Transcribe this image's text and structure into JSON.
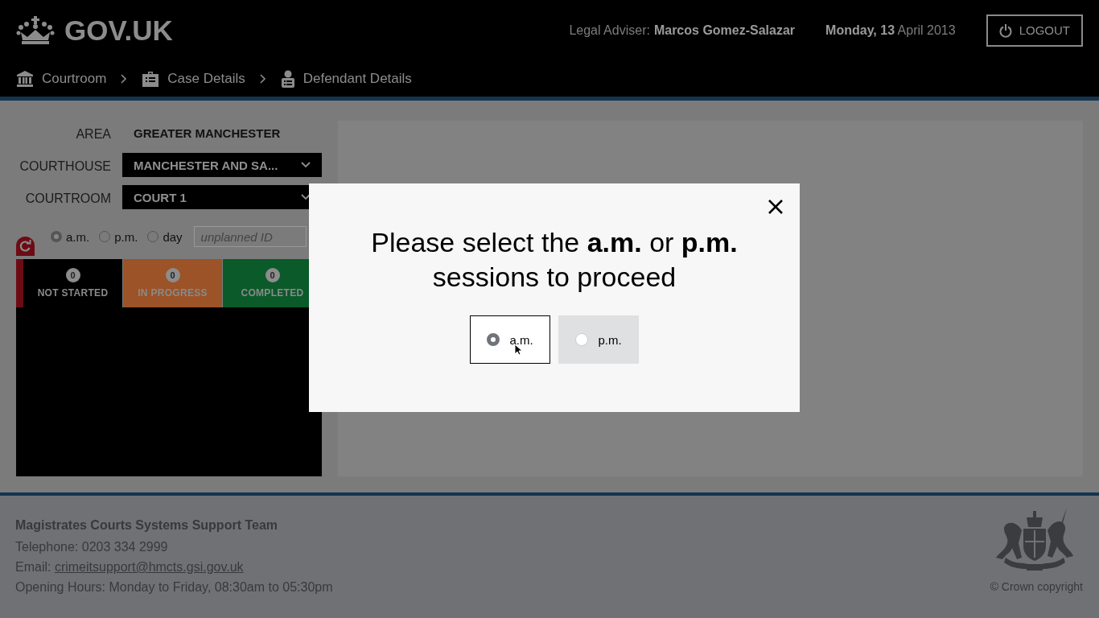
{
  "header": {
    "logo_text": "GOV.UK",
    "adviser_label": "Legal Adviser:",
    "adviser_name": "Marcos Gomez-Salazar",
    "date": "**Monday, 13** April 2013",
    "logout": "LOGOUT"
  },
  "breadcrumbs": [
    {
      "label": "Courtroom",
      "kind": "courthouse"
    },
    {
      "label": "Case Details",
      "kind": "briefcase"
    },
    {
      "label": "Defendant Details",
      "kind": "person"
    }
  ],
  "filters": [
    {
      "label": "AREA",
      "value": "GREATER MANCHESTER",
      "kind": "text"
    },
    {
      "label": "COURTHOUSE",
      "value": "MANCHESTER AND SA...",
      "kind": "select"
    },
    {
      "label": "COURTROOM",
      "value": "COURT 1",
      "kind": "select"
    }
  ],
  "sessions": [
    {
      "label": "a.m.",
      "selected": true
    },
    {
      "label": "p.m.",
      "selected": false
    },
    {
      "label": "day",
      "selected": false
    }
  ],
  "unplanned": {
    "placeholder": "unplanned ID"
  },
  "tiles": [
    {
      "count": "0",
      "label": "NOT STARTED",
      "color": "#000000",
      "selected": true
    },
    {
      "count": "0",
      "label": "IN PROGRESS",
      "color": "#9c5327",
      "selected": false
    },
    {
      "count": "0",
      "label": "COMPLETED",
      "color": "#0b5a2a",
      "selected": false
    }
  ],
  "modal": {
    "message": "Please select the **a.m.** or **p.m.** sessions to proceed",
    "options": [
      {
        "label": "a.m.",
        "selected": true
      },
      {
        "label": "p.m.",
        "selected": false
      }
    ]
  },
  "footer": {
    "team": "Magistrates Courts Systems Support Team",
    "telephone": "Telephone: 0203 334 2999",
    "email_label": "Email:",
    "email": "crimeitsupport@hmcts.gsi.gov.uk",
    "hours": "Opening Hours: Monday to Friday, 08:30am to 05:30pm",
    "copyright": "© Crown copyright"
  }
}
